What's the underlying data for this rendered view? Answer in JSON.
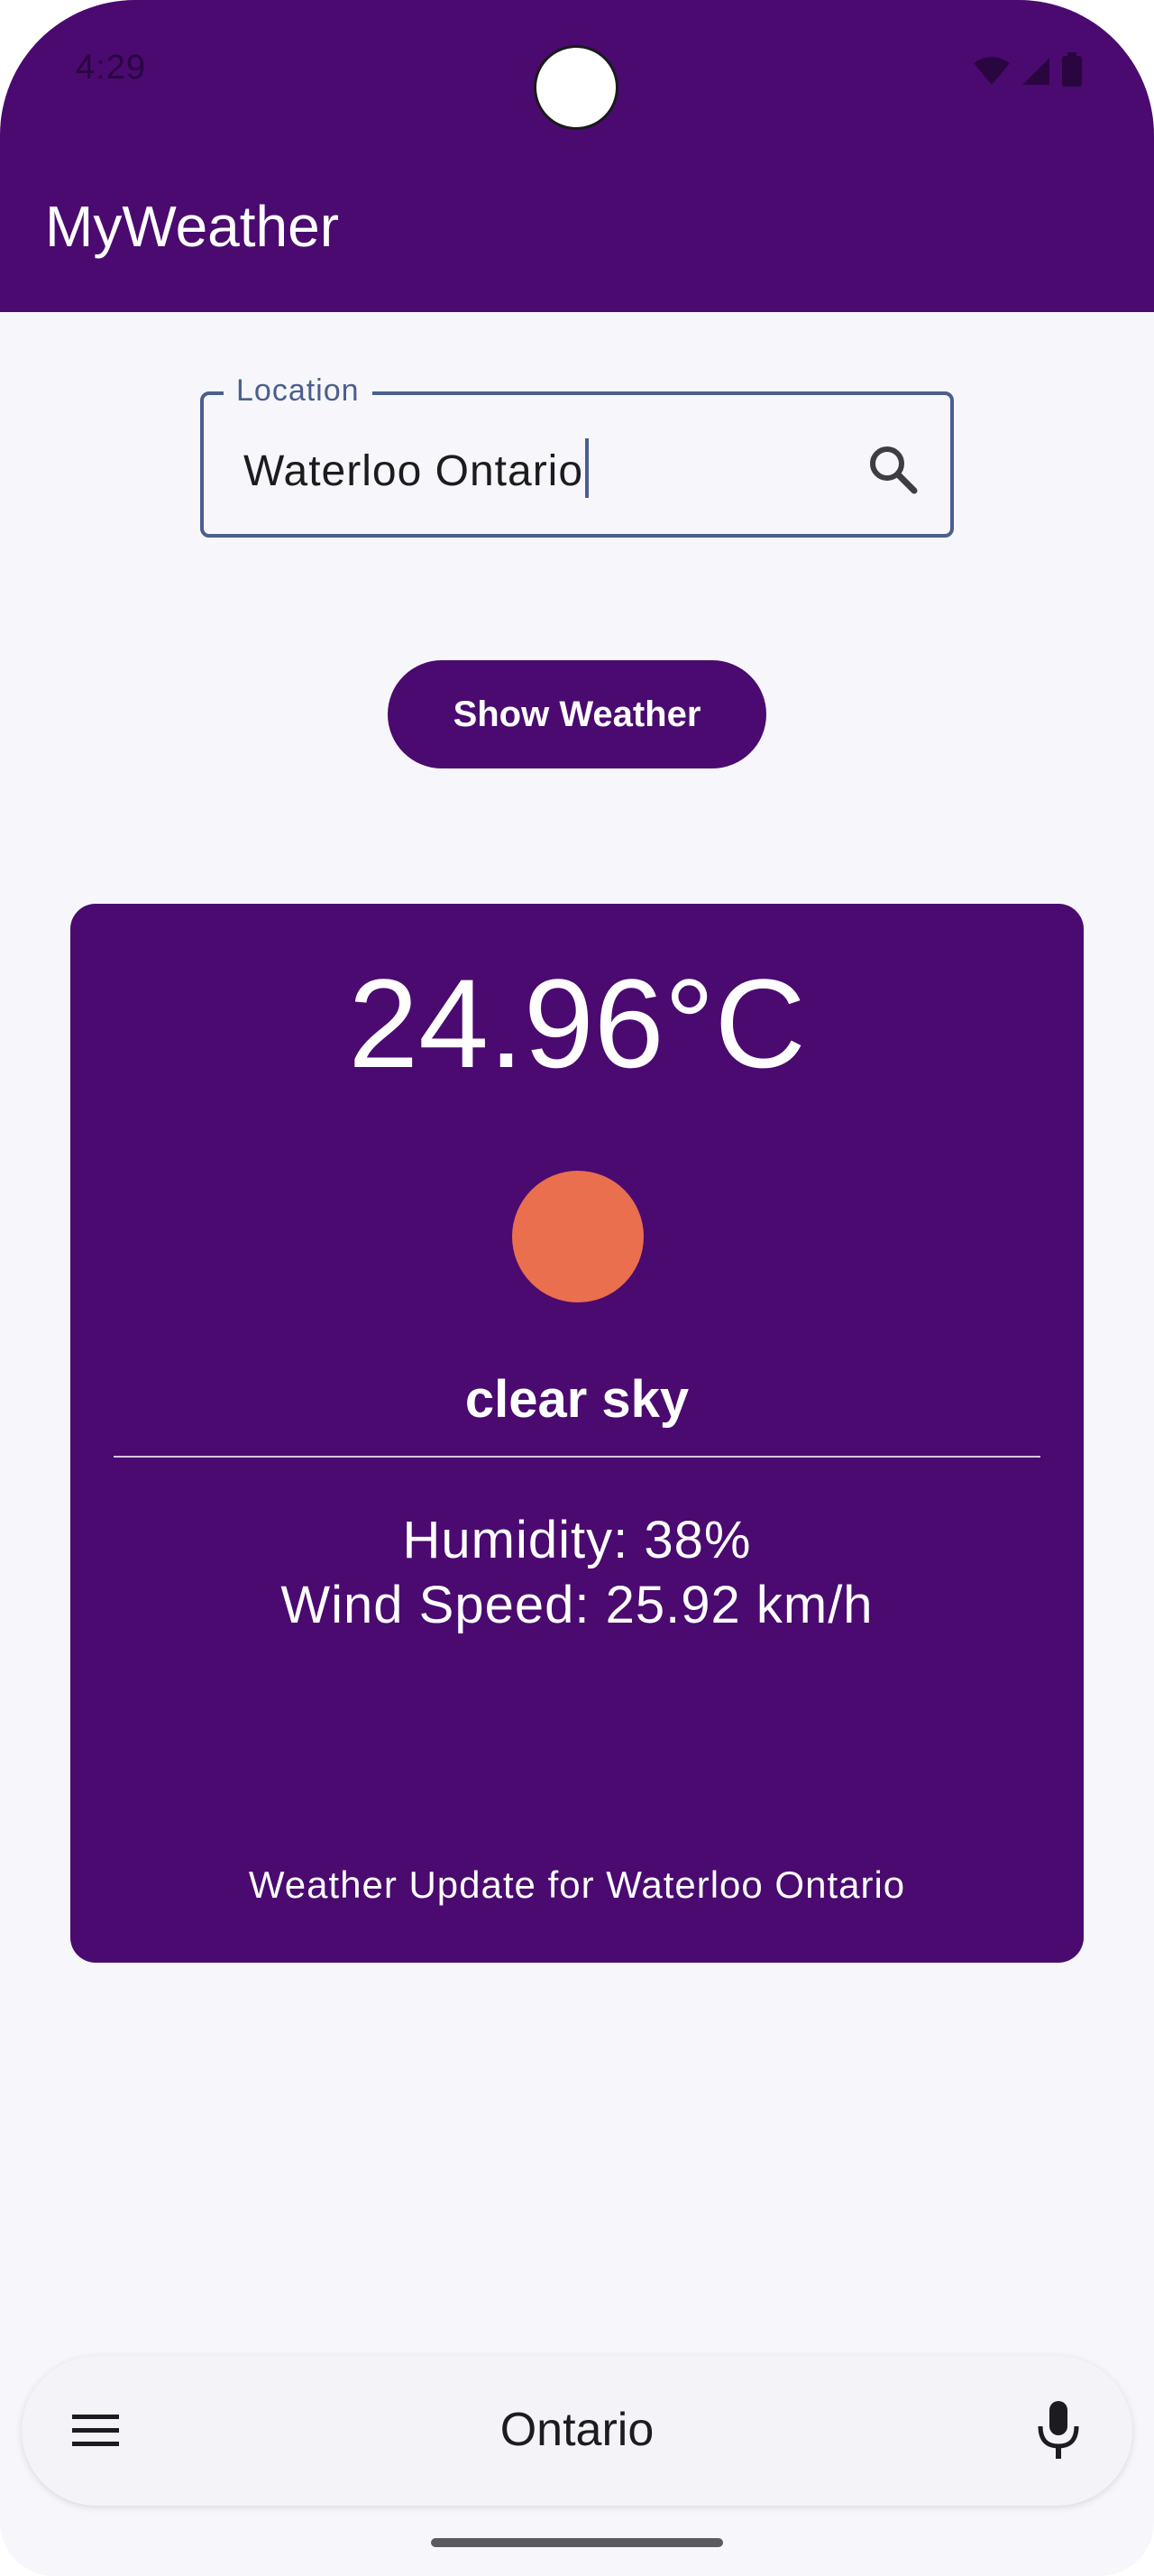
{
  "status_bar": {
    "time": "4:29",
    "icons": [
      "wifi-icon",
      "signal-icon",
      "battery-icon"
    ]
  },
  "app_bar": {
    "title": "MyWeather"
  },
  "search": {
    "label": "Location",
    "value": "Waterloo Ontario",
    "icon": "search-icon"
  },
  "actions": {
    "show_weather_label": "Show Weather"
  },
  "weather_card": {
    "temperature": "24.96°C",
    "icon": "sun-icon",
    "condition": "clear sky",
    "humidity": "Humidity: 38%",
    "wind_speed": "Wind Speed: 25.92 km/h",
    "update_text": "Weather Update for Waterloo Ontario"
  },
  "bottom_bar": {
    "menu_icon": "menu-icon",
    "text": "Ontario",
    "mic_icon": "mic-icon"
  },
  "colors": {
    "primary": "#4a0a70",
    "outline": "#4a5f8e",
    "sun": "#ea6f4f",
    "background": "#f7f6fb"
  }
}
